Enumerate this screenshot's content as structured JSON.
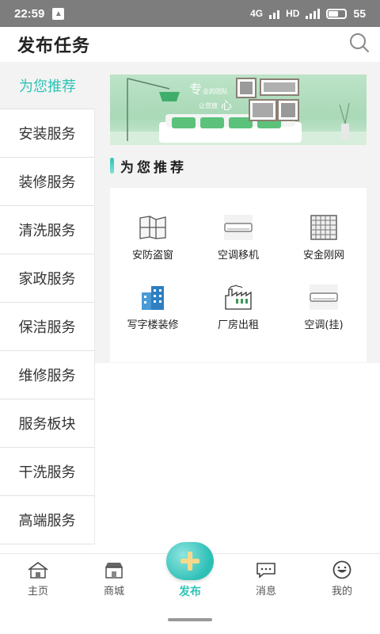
{
  "status": {
    "time": "22:59",
    "network": "4G",
    "hd": "HD",
    "battery": "55"
  },
  "header": {
    "title": "发布任务"
  },
  "sidebar": {
    "items": [
      {
        "label": "为您推荐",
        "active": true
      },
      {
        "label": "安装服务"
      },
      {
        "label": "装修服务"
      },
      {
        "label": "清洗服务"
      },
      {
        "label": "家政服务"
      },
      {
        "label": "保洁服务"
      },
      {
        "label": "维修服务"
      },
      {
        "label": "服务板块"
      },
      {
        "label": "干洗服务"
      },
      {
        "label": "高端服务"
      }
    ]
  },
  "banner": {
    "line1_big": "专",
    "line1": "业的团队",
    "line2": "让您放",
    "line2_big": "心"
  },
  "section": {
    "title": "为您推荐"
  },
  "grid": {
    "items": [
      {
        "label": "安防盗窗",
        "icon": "window-icon"
      },
      {
        "label": "空调移机",
        "icon": "air-conditioner-icon"
      },
      {
        "label": "安金刚网",
        "icon": "mesh-icon"
      },
      {
        "label": "写字楼装修",
        "icon": "office-building-icon"
      },
      {
        "label": "厂房出租",
        "icon": "factory-icon"
      },
      {
        "label": "空调(挂)",
        "icon": "wall-ac-icon"
      }
    ]
  },
  "tabbar": {
    "items": [
      {
        "label": "主页",
        "icon": "home-icon"
      },
      {
        "label": "商城",
        "icon": "shop-icon"
      },
      {
        "label": "发布",
        "icon": "plus-icon",
        "active": true
      },
      {
        "label": "消息",
        "icon": "message-icon"
      },
      {
        "label": "我的",
        "icon": "smile-icon"
      }
    ]
  },
  "colors": {
    "accent": "#2ec4b6",
    "statusbar": "#7d7d7d",
    "sidebar_active_bg": "#f3f3f3"
  }
}
